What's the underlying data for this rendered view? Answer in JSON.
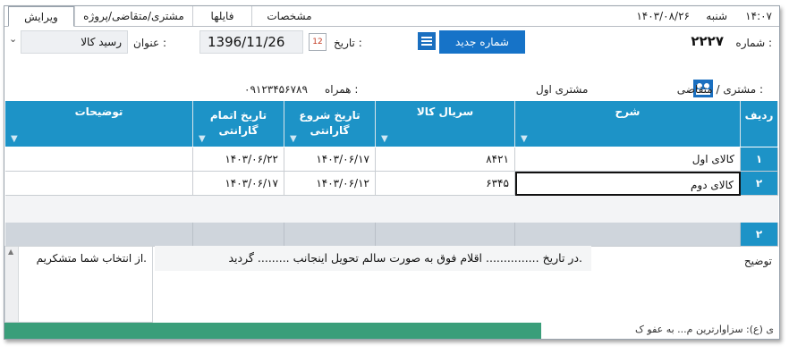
{
  "tabs": [
    {
      "id": "edit",
      "label": "ویرایش"
    },
    {
      "id": "customer",
      "label": "مشتری/متقاضی/پروژه"
    },
    {
      "id": "files",
      "label": "فایلها"
    },
    {
      "id": "specs",
      "label": "مشخصات"
    }
  ],
  "header": {
    "time": "۱۴:۰۷",
    "day": "شنبه",
    "date": "۱۴۰۳/۰۸/۲۶"
  },
  "form": {
    "number_label": "شماره :",
    "number_value": "۲۲۲۷",
    "new_number_button": "شماره جدید",
    "date_label": "تاریخ :",
    "date_value": "1396/11/26",
    "title_label": "عنوان :",
    "title_value": "رسید کالا",
    "customer_label": "مشتری / متقاضی :",
    "customer_value": "مشتری اول",
    "mobile_label": "همراه :",
    "mobile_value": "۰۹۱۲۳۴۵۶۷۸۹",
    "calendar_day": "12"
  },
  "grid": {
    "columns": [
      "ردیف",
      "شرح",
      "سریال کالا",
      "تاریخ شروع گارانتی",
      "تاریخ اتمام گارانتی",
      "توضیحات"
    ],
    "rows": [
      {
        "n": "۱",
        "desc": "کالای اول",
        "serial": "۸۴۲۱",
        "start": "۱۴۰۳/۰۶/۱۷",
        "end": "۱۴۰۳/۰۶/۲۲",
        "notes": ""
      },
      {
        "n": "۲",
        "desc": "کالای دوم",
        "serial": "۶۳۴۵",
        "start": "۱۴۰۳/۰۶/۱۲",
        "end": "۱۴۰۳/۰۶/۱۷",
        "notes": ""
      }
    ],
    "summary_count": "۲"
  },
  "footer": {
    "description_label": "توضیح",
    "description_text": "در تاریخ ............... اقلام فوق  به صورت سالم تحویل اینجانب ......... گردید.",
    "closing_text": "از انتخاب شما متشکریم.",
    "bottom_snippet": "ی (ع): سزاوارترین م... به عفو ک"
  },
  "colors": {
    "accent": "#1d93c7",
    "button": "#1673c8"
  }
}
